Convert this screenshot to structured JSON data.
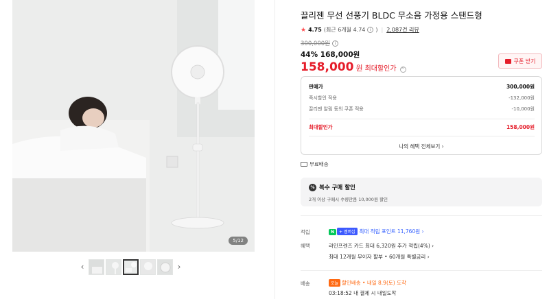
{
  "gallery": {
    "page_indicator": "5/12",
    "prev_arrow": "‹",
    "next_arrow": "›",
    "thumbnails": [
      {
        "label": "thumbnail-1"
      },
      {
        "label": "thumbnail-2"
      },
      {
        "label": "thumbnail-3"
      },
      {
        "label": "thumbnail-4"
      },
      {
        "label": "thumbnail-5"
      }
    ],
    "active_thumbnail_index": 2
  },
  "product": {
    "title": "끌리젠 무선 선풍기 BLDC 무소음 가정용 스탠드형",
    "rating": "4.75",
    "rating_recent": "(최근 6개월 4.74",
    "rating_recent_end": ")",
    "review_count": "2,087건 리뷰",
    "original_price": "300,000원",
    "discount_rate": "44%",
    "sale_price": "168,000원",
    "final_price": "158,000",
    "final_unit": "원",
    "final_label": "최대할인가",
    "coupon_button": "쿠폰 받기"
  },
  "price_breakdown": {
    "rows": [
      {
        "label": "판매가",
        "value": "300,000원"
      },
      {
        "label": "즉시할인 적용",
        "value": "-132,000원"
      },
      {
        "label": "끌리젠 알림 동의 쿠폰 적용",
        "value": "-10,000원"
      }
    ],
    "max_label": "최대할인가",
    "max_value": "158,000원",
    "benefits_link": "나의 혜택 전체보기 ›"
  },
  "shipping_note": "무료배송",
  "multi_purchase": {
    "title": "복수 구매 할인",
    "icon_text": "%",
    "description": "2개 이상 구매시 수량만큼 10,000원 할인"
  },
  "points": {
    "label": "적립",
    "npay": "N",
    "plus": "+ 멤버십",
    "text": "최대 적립 포인트 11,760원 ›"
  },
  "benefits": {
    "label": "혜택",
    "line1": "라인프렌즈 카드 최대 6,320원 추가 적립(4%) ›",
    "line2": "최대 12개월 무이자 할부 • 60개월 특별금리 ›"
  },
  "delivery": {
    "label": "배송",
    "badge": "오늘",
    "text": "할인배송 • 내일 8.9(토) 도착",
    "sub": "03:18:52  내 결제 시 내일도착"
  },
  "colors": {
    "accent_red": "#e51d2a",
    "point_blue": "#2e5bff",
    "delivery_orange": "#ff6a13"
  }
}
